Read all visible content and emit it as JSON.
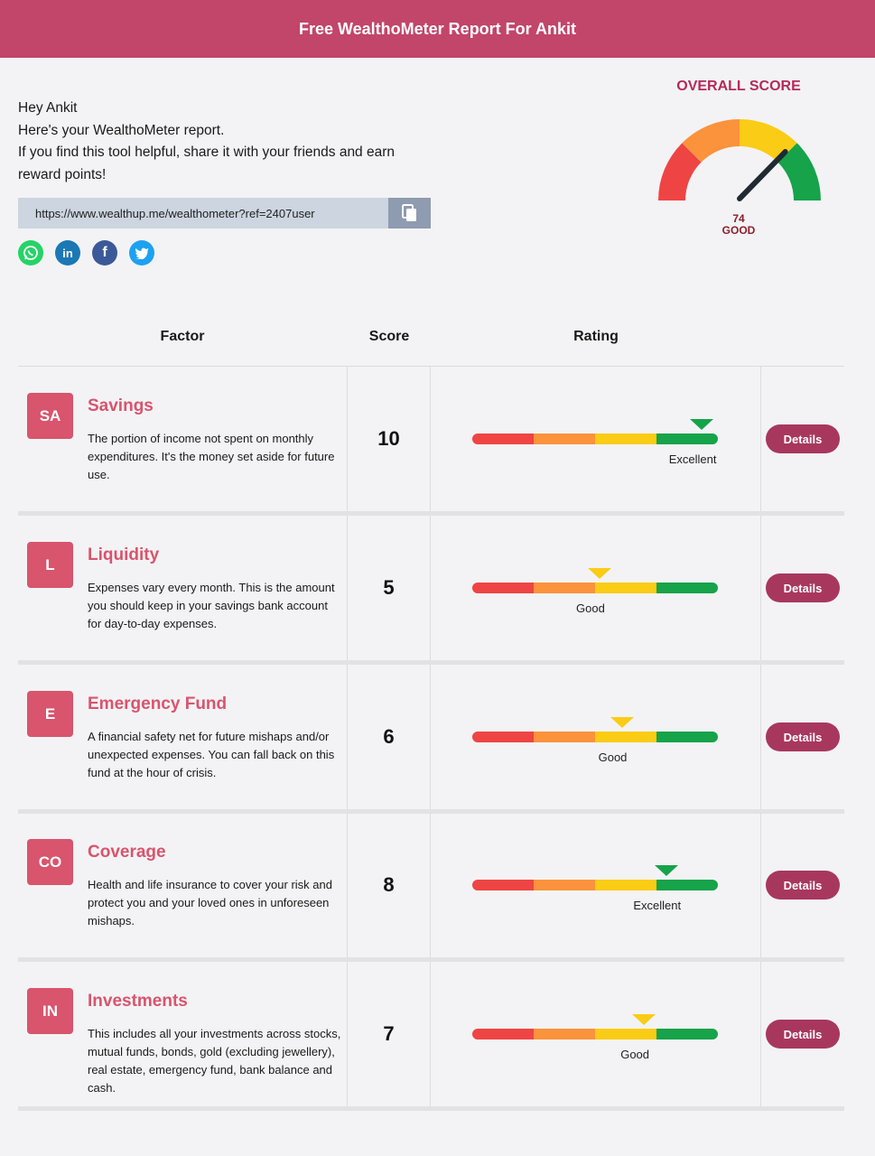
{
  "header": {
    "title": "Free WealthoMeter Report For Ankit"
  },
  "intro": {
    "line1": "Hey Ankit",
    "line2": "Here's your WealthoMeter report.",
    "line3": "If you find this tool helpful, share it with your friends and earn reward points!"
  },
  "share": {
    "url": "https://www.wealthup.me/wealthometer?ref=2407user",
    "copy_icon": "copy-icon",
    "socials": [
      {
        "name": "whatsapp-icon",
        "color": "#25d366"
      },
      {
        "name": "linkedin-icon",
        "color": "#1b78b5"
      },
      {
        "name": "facebook-icon",
        "color": "#3b5998"
      },
      {
        "name": "twitter-icon",
        "color": "#1da1f2"
      }
    ]
  },
  "overall": {
    "title": "OVERALL SCORE",
    "score": "74",
    "label": "GOOD",
    "score_value": 74,
    "max": 100
  },
  "table": {
    "col_factor": "Factor",
    "col_score": "Score",
    "col_rating": "Rating"
  },
  "rating_colors": [
    "#ef4444",
    "#fb923c",
    "#facc15",
    "#16a34a"
  ],
  "factors": [
    {
      "abbr": "SA",
      "title": "Savings",
      "desc": "The portion of income not spent on monthly expenditures. It's the money set aside for future use.",
      "score": "10",
      "rating": "Excellent",
      "level": 0.98,
      "details": "Details"
    },
    {
      "abbr": "L",
      "title": "Liquidity",
      "desc": "Expenses vary every month. This is the amount you should keep in your savings bank account for day-to-day expenses.",
      "score": "5",
      "rating": "Good",
      "level": 0.52,
      "details": "Details"
    },
    {
      "abbr": "E",
      "title": "Emergency Fund",
      "desc": "A financial safety net for future mishaps and/or unexpected expenses. You can fall back on this fund at the hour of crisis.",
      "score": "6",
      "rating": "Good",
      "level": 0.62,
      "details": "Details"
    },
    {
      "abbr": "CO",
      "title": "Coverage",
      "desc": "Health and life insurance to cover your risk and protect you and your loved ones in unforeseen mishaps.",
      "score": "8",
      "rating": "Excellent",
      "level": 0.82,
      "details": "Details"
    },
    {
      "abbr": "IN",
      "title": "Investments",
      "desc": "This includes all your investments across stocks, mutual funds, bonds, gold (excluding jewellery), real estate, emergency fund, bank balance and cash.",
      "score": "7",
      "rating": "Good",
      "level": 0.72,
      "details": "Details"
    }
  ]
}
